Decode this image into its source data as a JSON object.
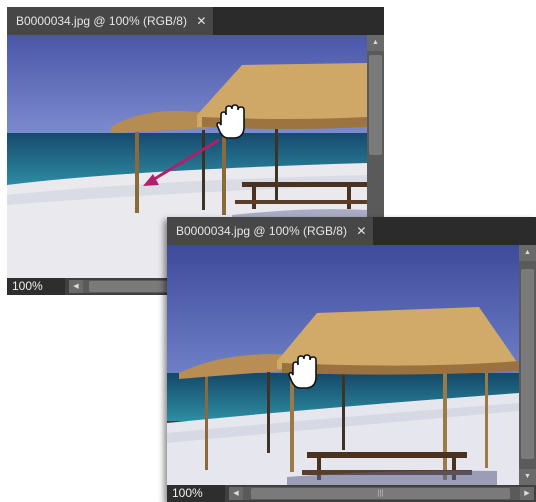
{
  "window_back": {
    "tab_title": "B0000034.jpg @ 100% (RGB/8)",
    "close_glyph": "✕",
    "zoom_level": "100%"
  },
  "window_front": {
    "tab_title": "B0000034.jpg @ 100% (RGB/8)",
    "close_glyph": "✕",
    "zoom_level": "100%"
  },
  "icons": {
    "hand_tool": "hand-tool-icon",
    "drag_arrow": "drag-direction-arrow"
  },
  "colors": {
    "arrow": "#b0206a",
    "panel": "#3c3c3c",
    "sky": "#5f6fb8",
    "sea": "#1f6f8a",
    "thatch": "#c9a264"
  }
}
